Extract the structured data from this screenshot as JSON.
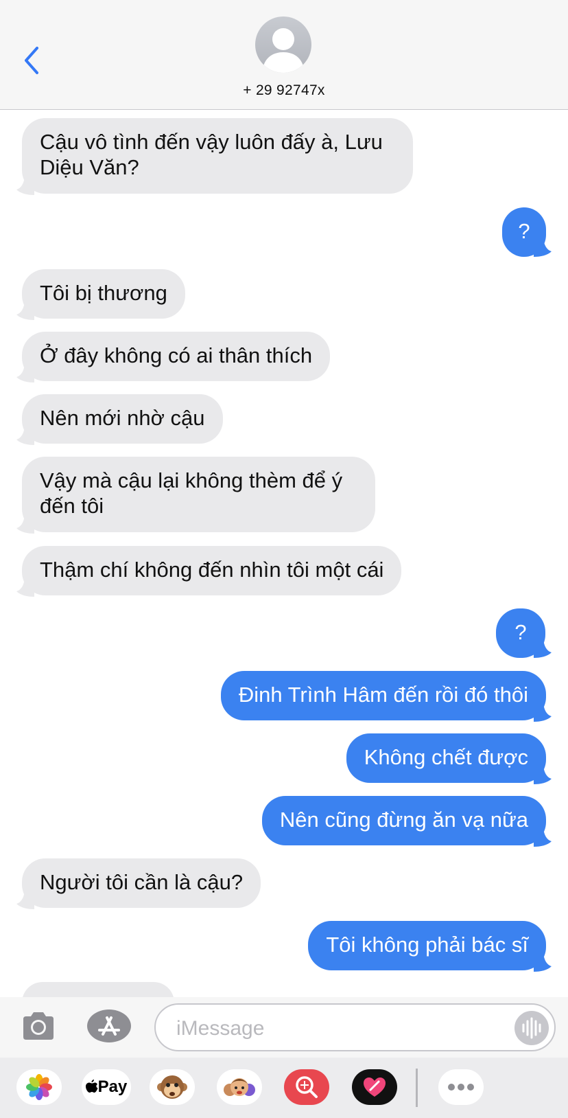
{
  "header": {
    "contact_name": "+ 29 92747x"
  },
  "messages": [
    {
      "direction": "in",
      "text": "Cậu vô tình đến vậy luôn đấy à, Lưu Diệu Văn?"
    },
    {
      "direction": "out",
      "text": "?"
    },
    {
      "direction": "in",
      "text": "Tôi bị thương"
    },
    {
      "direction": "in",
      "text": "Ở đây không có ai thân thích"
    },
    {
      "direction": "in",
      "text": "Nên mới nhờ cậu"
    },
    {
      "direction": "in",
      "text": "Vậy mà cậu lại không thèm để ý đến tôi"
    },
    {
      "direction": "in",
      "text": "Thậm chí không đến nhìn tôi một cái"
    },
    {
      "direction": "out",
      "text": "?"
    },
    {
      "direction": "out",
      "text": "Đinh Trình Hâm đến rồi đó thôi"
    },
    {
      "direction": "out",
      "text": "Không chết được"
    },
    {
      "direction": "out",
      "text": "Nên cũng đừng ăn vạ nữa"
    },
    {
      "direction": "in",
      "text": "Người tôi cần là cậu?"
    },
    {
      "direction": "out",
      "text": "Tôi không phải bác sĩ"
    }
  ],
  "composer": {
    "placeholder": "iMessage"
  },
  "app_strip": {
    "pay_label": "Pay",
    "apps": [
      "photos-icon",
      "apple-pay-icon",
      "memoji-monkey-icon",
      "memoji-group-icon",
      "image-search-icon",
      "digital-touch-icon",
      "more-icon"
    ]
  },
  "colors": {
    "incoming_bubble": "#e9e9eb",
    "outgoing_bubble": "#3b82f0",
    "accent": "#3478f6"
  }
}
